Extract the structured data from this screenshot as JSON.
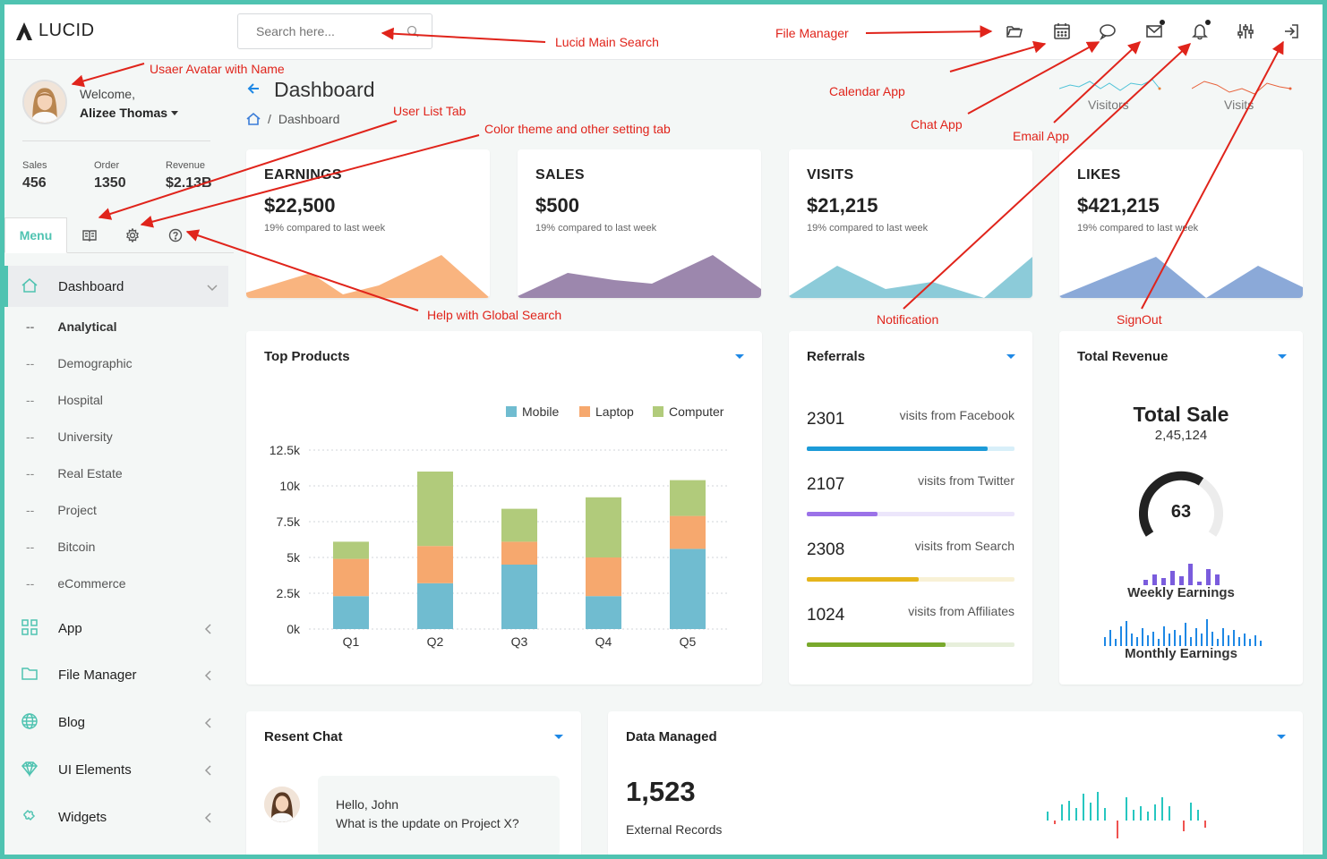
{
  "brand": {
    "name": "LUCID"
  },
  "search": {
    "placeholder": "Search here..."
  },
  "user": {
    "welcome": "Welcome,",
    "name": "Alizee Thomas"
  },
  "stats": [
    {
      "label": "Sales",
      "value": "456"
    },
    {
      "label": "Order",
      "value": "1350"
    },
    {
      "label": "Revenue",
      "value": "$2.13B"
    }
  ],
  "sidebar_tabs": {
    "menu_label": "Menu"
  },
  "nav": {
    "dashboard": "Dashboard",
    "sub_items": [
      "Analytical",
      "Demographic",
      "Hospital",
      "University",
      "Real Estate",
      "Project",
      "Bitcoin",
      "eCommerce"
    ],
    "sub_dash": "--",
    "app": "App",
    "file_manager": "File Manager",
    "blog": "Blog",
    "ui_elements": "UI Elements",
    "widgets": "Widgets"
  },
  "page": {
    "title": "Dashboard",
    "breadcrumb_sep": "/",
    "breadcrumb": "Dashboard"
  },
  "header_sparks": {
    "visitors_label": "Visitors",
    "visits_label": "Visits"
  },
  "kpis": [
    {
      "title": "EARNINGS",
      "value": "$22,500",
      "sub": "19% compared to last week",
      "color": "#f9b47f"
    },
    {
      "title": "SALES",
      "value": "$500",
      "sub": "19% compared to last week",
      "color": "#8e7aa6"
    },
    {
      "title": "VISITS",
      "value": "$21,215",
      "sub": "19% compared to last week",
      "color": "#7cc5d4"
    },
    {
      "title": "LIKES",
      "value": "$421,215",
      "sub": "19% compared to last week",
      "color": "#7c9fd2"
    }
  ],
  "top_products": {
    "title": "Top Products"
  },
  "chart_data": {
    "type": "bar",
    "stacked": true,
    "title": "Top Products",
    "categories": [
      "Q1",
      "Q2",
      "Q3",
      "Q4",
      "Q5"
    ],
    "series": [
      {
        "name": "Mobile",
        "color": "#70bcd0",
        "values": [
          2300,
          3200,
          4500,
          2300,
          5600
        ]
      },
      {
        "name": "Laptop",
        "color": "#f6a86e",
        "values": [
          2600,
          2600,
          1600,
          2700,
          2300
        ]
      },
      {
        "name": "Computer",
        "color": "#b1cb7b",
        "values": [
          1200,
          5200,
          2300,
          4200,
          2500
        ]
      }
    ],
    "yticks": [
      "0k",
      "2.5k",
      "5k",
      "7.5k",
      "10k",
      "12.5k"
    ],
    "ylim": [
      0,
      12500
    ],
    "grid": true,
    "legend": "top-right"
  },
  "referrals": {
    "title": "Referrals",
    "items": [
      {
        "count": "2301",
        "label": "visits from Facebook",
        "pct": 87,
        "color": "#1d9bd8",
        "track": "#d8eff9"
      },
      {
        "count": "2107",
        "label": "visits from Twitter",
        "pct": 34,
        "color": "#9b72e8",
        "track": "#ece6fb"
      },
      {
        "count": "2308",
        "label": "visits from Search",
        "pct": 54,
        "color": "#e5b51c",
        "track": "#f8f1d6"
      },
      {
        "count": "1024",
        "label": "visits from Affiliates",
        "pct": 67,
        "color": "#79a92c",
        "track": "#e7efdb"
      }
    ]
  },
  "total_revenue": {
    "title": "Total Revenue",
    "heading": "Total Sale",
    "value": "2,45,124",
    "gauge_value": "63",
    "gauge_fraction": 0.63,
    "weekly_label": "Weekly Earnings",
    "monthly_label": "Monthly Earnings"
  },
  "recent_chat": {
    "title": "Resent Chat",
    "message_line1": "Hello, John",
    "message_line2": "What is the update on Project X?"
  },
  "data_managed": {
    "title": "Data Managed",
    "value": "1,523",
    "label": "External Records"
  },
  "annotations": {
    "avatar": "Usaer Avatar with Name",
    "user_list": "User List Tab",
    "theme": "Color theme and other setting tab",
    "help": "Help with Global Search",
    "search": "Lucid Main Search",
    "file_manager": "File Manager",
    "calendar": "Calendar App",
    "chat": "Chat App",
    "email": "Email App",
    "notification": "Notification",
    "signout": "SignOut"
  }
}
